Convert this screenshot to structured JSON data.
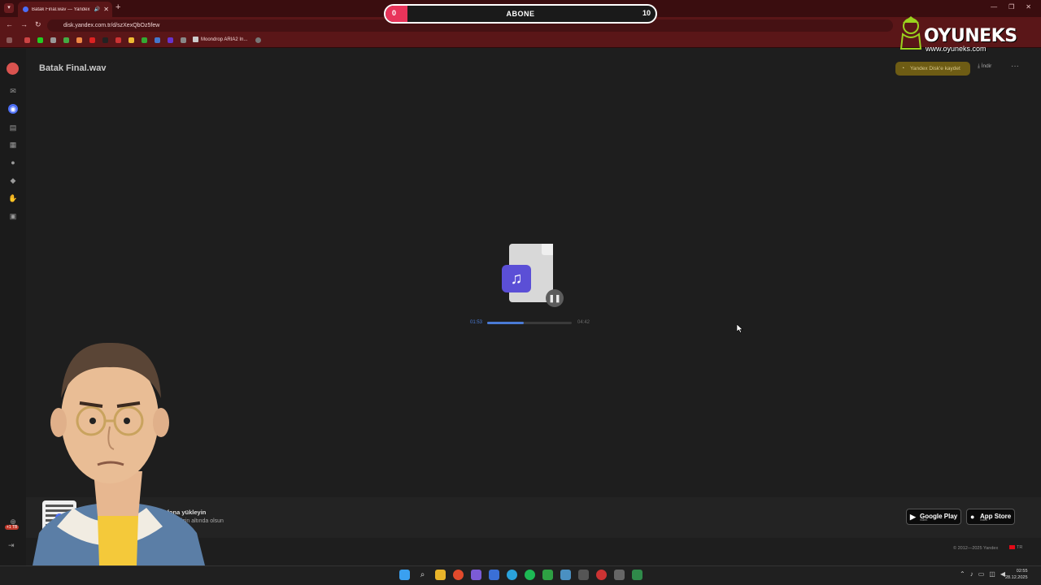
{
  "browser": {
    "tab_title": "Batak Final.wav — Yandex Disk",
    "tab_close": "✕",
    "new_tab": "+",
    "tab_menu": "▾",
    "url": "disk.yandex.com.tr/d/szXexQbOz5few",
    "bookmark_label": "Moondrop ARIA2 In...",
    "window_controls": [
      "—",
      "❐",
      "✕"
    ]
  },
  "overlay": {
    "subscribe_label": "ABONE",
    "current_count": "0",
    "goal": "10",
    "progress_fraction": 0.04
  },
  "watermark": {
    "name": "OYUNEKS",
    "url": "www.oyuneks.com"
  },
  "header": {
    "file_title": "Batak Final.wav",
    "save_label": "Yandex Disk'e kaydet",
    "download_label": "İndir",
    "more_label": "···"
  },
  "player": {
    "current_time": "01:53",
    "total_time": "04:42",
    "progress_fraction": 0.43,
    "pause_label": "❚❚",
    "note_glyph": "♫"
  },
  "promo": {
    "title_prefix": "Y",
    "title": "ası telefona yükleyin",
    "subtitle": "niz daima elinizin altında olsun",
    "google_play": "Google Play",
    "google_play_sub": "indirin",
    "app_store": "App Store",
    "app_store_sub": "indirin"
  },
  "footer": {
    "copyright": "© 2012—2025 Yandex",
    "language": "TR",
    "storage_badge": "+1 TB"
  },
  "taskbar": {
    "time": "02:55",
    "date": "28.12.2025"
  },
  "colors": {
    "accent_subscribe": "#e8345a",
    "player_accent": "#4a7bd6",
    "save_button": "#6e5c14",
    "browser_theme": "#5a1618"
  }
}
